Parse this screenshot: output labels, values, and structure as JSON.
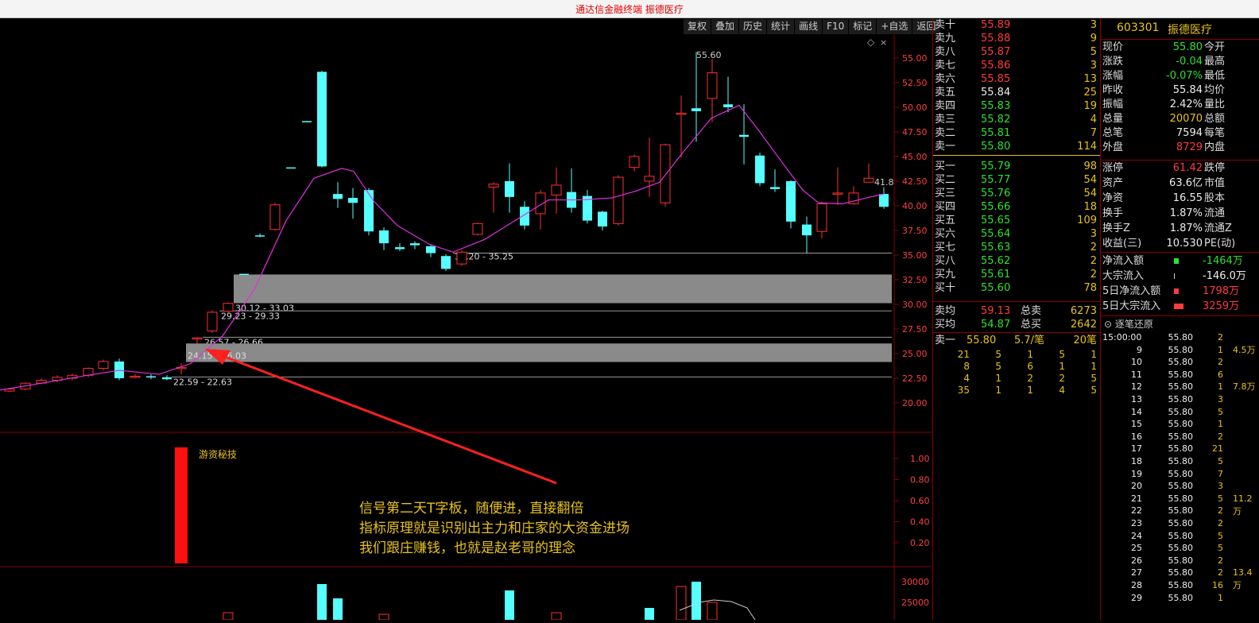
{
  "app_title": "通达信金融终端 振德医疗",
  "toolbar": [
    "复权",
    "叠加",
    "历史",
    "统计",
    "画线",
    "F10",
    "标记",
    "+自选",
    "返回"
  ],
  "chart": {
    "price_axis": [
      "55.00",
      "52.50",
      "50.00",
      "47.50",
      "45.00",
      "42.50",
      "40.00",
      "37.50",
      "35.00",
      "32.50",
      "30.00",
      "27.50",
      "25.00",
      "22.50",
      "20.00"
    ],
    "high_label": "55.60",
    "right_label": "41.8",
    "zones": [
      "35.20 - 35.25",
      "30.12 - 33.03",
      "29.23 - 29.33",
      "26.57 - 26.66",
      "24.15 - 26.03",
      "22.59 - 22.63"
    ],
    "indicator_name": "游资秘技",
    "indicator_axis": [
      "1.00",
      "0.80",
      "0.60",
      "0.40",
      "0.20"
    ],
    "volume_axis": [
      "30000",
      "25000"
    ],
    "annotation": [
      "信号第二天T字板，随便进，直接翻倍",
      "指标原理就是识别出主力和庄家的大资金进场",
      "我们跟庄赚钱，也就是赵老哥的理念"
    ]
  },
  "orderbook": {
    "asks": [
      {
        "label": "卖十",
        "price": "55.89",
        "vol": "3"
      },
      {
        "label": "卖九",
        "price": "55.88",
        "vol": "9"
      },
      {
        "label": "卖八",
        "price": "55.87",
        "vol": "5"
      },
      {
        "label": "卖七",
        "price": "55.86",
        "vol": "3"
      },
      {
        "label": "卖六",
        "price": "55.85",
        "vol": "13"
      },
      {
        "label": "卖五",
        "price": "55.84",
        "vol": "25"
      },
      {
        "label": "卖四",
        "price": "55.83",
        "vol": "19"
      },
      {
        "label": "卖三",
        "price": "55.82",
        "vol": "4"
      },
      {
        "label": "卖二",
        "price": "55.81",
        "vol": "7"
      },
      {
        "label": "卖一",
        "price": "55.80",
        "vol": "114"
      }
    ],
    "bids": [
      {
        "label": "买一",
        "price": "55.79",
        "vol": "98"
      },
      {
        "label": "买二",
        "price": "55.77",
        "vol": "54"
      },
      {
        "label": "买三",
        "price": "55.76",
        "vol": "54"
      },
      {
        "label": "买四",
        "price": "55.66",
        "vol": "18"
      },
      {
        "label": "买五",
        "price": "55.65",
        "vol": "109"
      },
      {
        "label": "买六",
        "price": "55.64",
        "vol": "3"
      },
      {
        "label": "买七",
        "price": "55.63",
        "vol": "2"
      },
      {
        "label": "买八",
        "price": "55.62",
        "vol": "2"
      },
      {
        "label": "买九",
        "price": "55.61",
        "vol": "2"
      },
      {
        "label": "买十",
        "price": "55.60",
        "vol": "78"
      }
    ],
    "sell_avg_label": "卖均",
    "sell_avg": "59.13",
    "sell_total_label": "总卖",
    "sell_total": "6273",
    "buy_avg_label": "买均",
    "buy_avg": "54.87",
    "buy_total_label": "总买",
    "buy_total": "2642",
    "ask1_label": "卖一",
    "ask1_price": "55.80",
    "ask1_per": "5.7/笔",
    "ask1_count": "20笔",
    "queue": [
      [
        "21",
        "5",
        "1",
        "5",
        "1"
      ],
      [
        "8",
        "5",
        "6",
        "1",
        "1"
      ],
      [
        "4",
        "1",
        "2",
        "2",
        "5"
      ],
      [
        "35",
        "1",
        "1",
        "4",
        "5"
      ]
    ]
  },
  "quote": {
    "code": "603301",
    "name": "振德医疗",
    "rows1": [
      {
        "k": "现价",
        "v": "55.80",
        "k2": "今开"
      },
      {
        "k": "涨跌",
        "v": "-0.04",
        "k2": "最高"
      },
      {
        "k": "涨幅",
        "v": "-0.07%",
        "k2": "最低"
      },
      {
        "k": "昨收",
        "v": "55.84",
        "k2": "均价"
      },
      {
        "k": "振幅",
        "v": "2.42%",
        "k2": "量比"
      },
      {
        "k": "总量",
        "v": "20070",
        "k2": "总额"
      },
      {
        "k": "总笔",
        "v": "7594",
        "k2": "每笔"
      },
      {
        "k": "外盘",
        "v": "8729",
        "k2": "内盘"
      }
    ],
    "rows2": [
      {
        "k": "涨停",
        "v": "61.42",
        "k2": "跌停"
      },
      {
        "k": "资产",
        "v": "63.6亿",
        "k2": "市值"
      },
      {
        "k": "净资",
        "v": "16.55",
        "k2": "股本"
      },
      {
        "k": "换手",
        "v": "1.87%",
        "k2": "流通"
      },
      {
        "k": "换手Z",
        "v": "1.87%",
        "k2": "流通Z"
      },
      {
        "k": "收益(三)",
        "v": "10.530",
        "k2": "PE(动)"
      }
    ],
    "flows": [
      {
        "k": "净流入额",
        "v": "-1464万"
      },
      {
        "k": "大宗流入",
        "v": "-146.0万"
      },
      {
        "k": "5日净流入额",
        "v": "1798万"
      },
      {
        "k": "5日大宗流入",
        "v": "3259万"
      }
    ],
    "trades_title": "逐笔还原",
    "trades": [
      {
        "t": "15:00:00",
        "p": "55.80",
        "v": "2",
        "x": ""
      },
      {
        "t": "9",
        "p": "55.80",
        "v": "1",
        "x": "4.5万"
      },
      {
        "t": "10",
        "p": "55.80",
        "v": "2",
        "x": ""
      },
      {
        "t": "11",
        "p": "55.80",
        "v": "6",
        "x": ""
      },
      {
        "t": "12",
        "p": "55.80",
        "v": "1",
        "x": "7.8万"
      },
      {
        "t": "13",
        "p": "55.80",
        "v": "3",
        "x": ""
      },
      {
        "t": "14",
        "p": "55.80",
        "v": "5",
        "x": ""
      },
      {
        "t": "15",
        "p": "55.80",
        "v": "1",
        "x": ""
      },
      {
        "t": "16",
        "p": "55.80",
        "v": "2",
        "x": ""
      },
      {
        "t": "17",
        "p": "55.80",
        "v": "21",
        "x": ""
      },
      {
        "t": "18",
        "p": "55.80",
        "v": "5",
        "x": ""
      },
      {
        "t": "19",
        "p": "55.80",
        "v": "7",
        "x": ""
      },
      {
        "t": "20",
        "p": "55.80",
        "v": "3",
        "x": ""
      },
      {
        "t": "21",
        "p": "55.80",
        "v": "5",
        "x": "11.2万"
      },
      {
        "t": "22",
        "p": "55.80",
        "v": "2",
        "x": ""
      },
      {
        "t": "23",
        "p": "55.80",
        "v": "2",
        "x": ""
      },
      {
        "t": "24",
        "p": "55.80",
        "v": "5",
        "x": ""
      },
      {
        "t": "25",
        "p": "55.80",
        "v": "5",
        "x": ""
      },
      {
        "t": "26",
        "p": "55.80",
        "v": "2",
        "x": ""
      },
      {
        "t": "27",
        "p": "55.80",
        "v": "2",
        "x": "13.4万"
      },
      {
        "t": "28",
        "p": "55.80",
        "v": "16",
        "x": ""
      },
      {
        "t": "29",
        "p": "55.80",
        "v": "1",
        "x": ""
      }
    ]
  }
}
